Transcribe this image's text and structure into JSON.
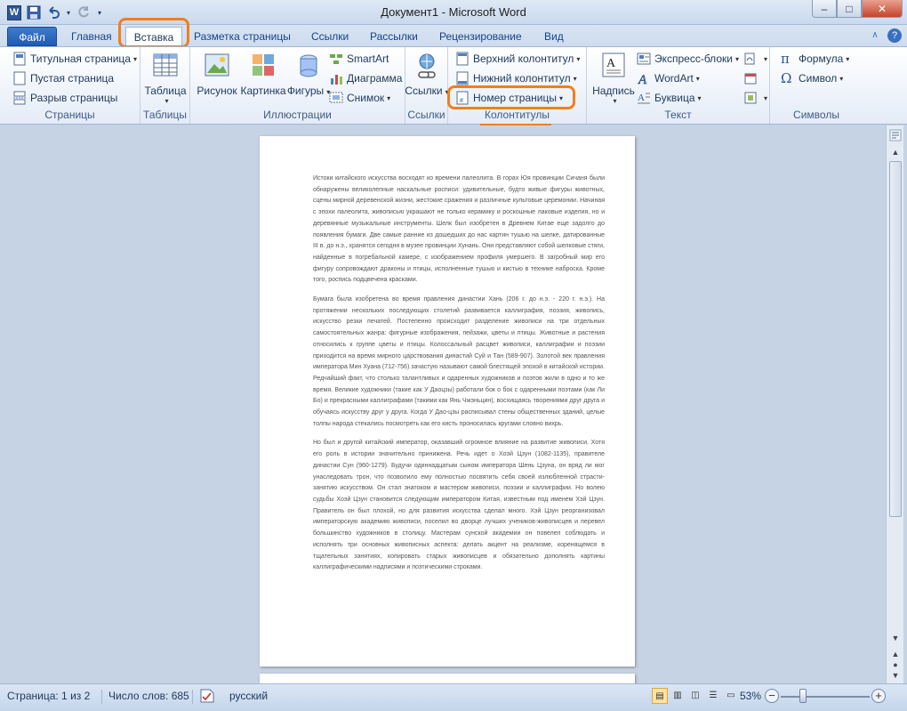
{
  "window": {
    "title": "Документ1  -  Microsoft Word",
    "app_badge": "W",
    "min_glyph": "–",
    "max_glyph": "□",
    "close_glyph": "✕"
  },
  "qat": {
    "save_glyph": "💾",
    "undo_glyph": "↶",
    "redo_glyph": "↻"
  },
  "tabs": [
    {
      "label": "Файл"
    },
    {
      "label": "Главная"
    },
    {
      "label": "Вставка"
    },
    {
      "label": "Разметка страницы"
    },
    {
      "label": "Ссылки"
    },
    {
      "label": "Рассылки"
    },
    {
      "label": "Рецензирование"
    },
    {
      "label": "Вид"
    }
  ],
  "ribbon": {
    "pages": {
      "label": "Страницы",
      "items": [
        "Титульная страница",
        "Пустая страница",
        "Разрыв страницы"
      ]
    },
    "tables": {
      "label": "Таблицы",
      "table": "Таблица"
    },
    "illustrations": {
      "label": "Иллюстрации",
      "picture": "Рисунок",
      "clipart": "Картинка",
      "shapes": "Фигуры",
      "smartart": "SmartArt",
      "chart": "Диаграмма",
      "screenshot": "Снимок"
    },
    "links": {
      "label": "Ссылки",
      "links": "Ссылки"
    },
    "headers": {
      "label": "Колонтитулы",
      "header": "Верхний колонтитул",
      "footer": "Нижний колонтитул",
      "page_number": "Номер страницы"
    },
    "text": {
      "label": "Текст",
      "textbox": "Надпись",
      "quickparts": "Экспресс-блоки",
      "wordart": "WordArt",
      "dropcap": "Буквица"
    },
    "symbols": {
      "label": "Символы",
      "equation": "Формула",
      "symbol": "Символ"
    }
  },
  "document": {
    "paragraphs": [
      "Истоки китайского искусства восходят ко времени палеолита. В горах Юя провинции Сичаня были обнаружены великолепные наскальные росписи: удивительные, будто живые фигуры животных, сцены мирной деревенской жизни, жестокие сражения и различные культовые церемонии. Начиная с эпохи палеолита, живописью украшают не только керамику и роскошные лаковые изделия, но и деревянные музыкальные инструменты. Шелк был изобретен в Древнем Китае еще задолго до появления бумаги. Две самые ранние из дошедших до нас картин тушью на шелке, датированные III в. до н.э., хранятся сегодня в музее провинции Хунань. Они представляют собой шелковые стяги, найденные в погребальной камере, с изображением профиля умершего. В загробный мир его фигуру сопровождают драконы и птицы, исполненные тушью и кистью в технике наброска. Кроме того, роспись подцвечена красками.",
      "Бумага была изобретена во время правления династии Хань (206 г. до н.э. - 220 г. н.э.). На протяжении нескольких последующих столетий развивается каллиграфия, поэзия, живопись, искусство резки печатей. Постепенно происходит разделение живописи на три отдельных самостоятельных жанра: фигурные изображения, пейзажи, цветы и птицы. Животные и растения относились к группе цветы и птицы. Колоссальный расцвет живописи, каллиграфии и поэзии приходится на время мирного царствования династий Суй и Тан (589-907). Золотой век правления императора Мин Хуана (712-756) зачастую называют самой блестящей эпохой в китайской истории. Редчайший факт, что столько талантливых и одаренных художников и поэтов жили в одно и то же время. Великие художники (такие как У Даоцзы) работали бок о бок с одаренными поэтами (как Ли Бо) и прекрасными каллиграфами (такими как Янь Чжэньцин), восхищаясь творениями друг друга и обучаясь искусству друг у друга. Когда У Дао-цзы расписывал стены общественных зданий, целые толпы народа стекались посмотреть как его кисть проносилась кругами словно вихрь.",
      "Но был и другой китайский император, оказавший огромное влияние на развитие живописи. Хотя его роль в истории значительно принижена. Речь идет о Хоэй Цзун (1082-1135), правителе династии Сун (960-1279). Будучи одиннадцатым сыном императора Шень Цзуна, он вряд ли мог унаследовать трон, что позволило ему полностью посвятить себя своей излюбленной страсти-занятию искусством. Он стал знатоком и мастером живописи, поэзии и каллиграфии. Но волею судьбы Хоэй Цзун становится следующим императором Китая, известным под именем Хэй Цзун. Правитель он был плохой, но для развития искусства сделал много. Хэй Цзун реорганизовал императорскую академию живописи, поселил во дворце лучших учеников-живописцев и перевел большинство художников в столицу. Мастерам сунской академии он повелел соблюдать и исполнять три основных живописных аспекта: делать акцент на реализме, коренящемся в тщательных занятиях, копировать старых живописцев и обязательно дополнять картины каллиграфическими надписями и поэтическими строками."
    ]
  },
  "status": {
    "page": "Страница: 1 из 2",
    "words": "Число слов: 685",
    "language": "русский",
    "zoom": "53%",
    "zoom_minus": "−",
    "zoom_plus": "+"
  },
  "highlight_color": "#f07f1e"
}
